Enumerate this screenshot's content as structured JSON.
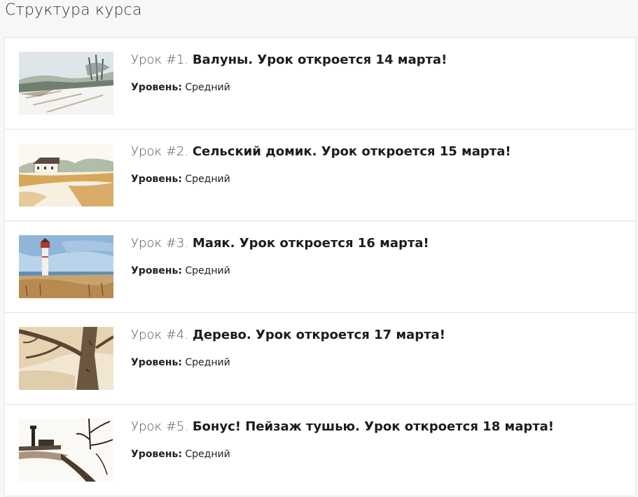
{
  "page": {
    "title": "Структура курса"
  },
  "lessons": [
    {
      "number": "Урок #1.",
      "title": "Валуны. Урок откроется 14 марта!",
      "level_label": "Уровень:",
      "level": "Средний",
      "thumbnail": "winter-landscape-painting"
    },
    {
      "number": "Урок #2.",
      "title": "Сельский домик. Урок откроется 15 марта!",
      "level_label": "Уровень:",
      "level": "Средний",
      "thumbnail": "country-house-painting"
    },
    {
      "number": "Урок #3.",
      "title": "Маяк. Урок откроется 16 марта!",
      "level_label": "Уровень:",
      "level": "Средний",
      "thumbnail": "lighthouse-painting"
    },
    {
      "number": "Урок #4.",
      "title": "Дерево. Урок откроется 17 марта!",
      "level_label": "Уровень:",
      "level": "Средний",
      "thumbnail": "tree-painting"
    },
    {
      "number": "Урок #5.",
      "title": "Бонус! Пейзаж тушью. Урок откроется 18 марта!",
      "level_label": "Уровень:",
      "level": "Средний",
      "thumbnail": "ink-landscape-painting"
    }
  ]
}
